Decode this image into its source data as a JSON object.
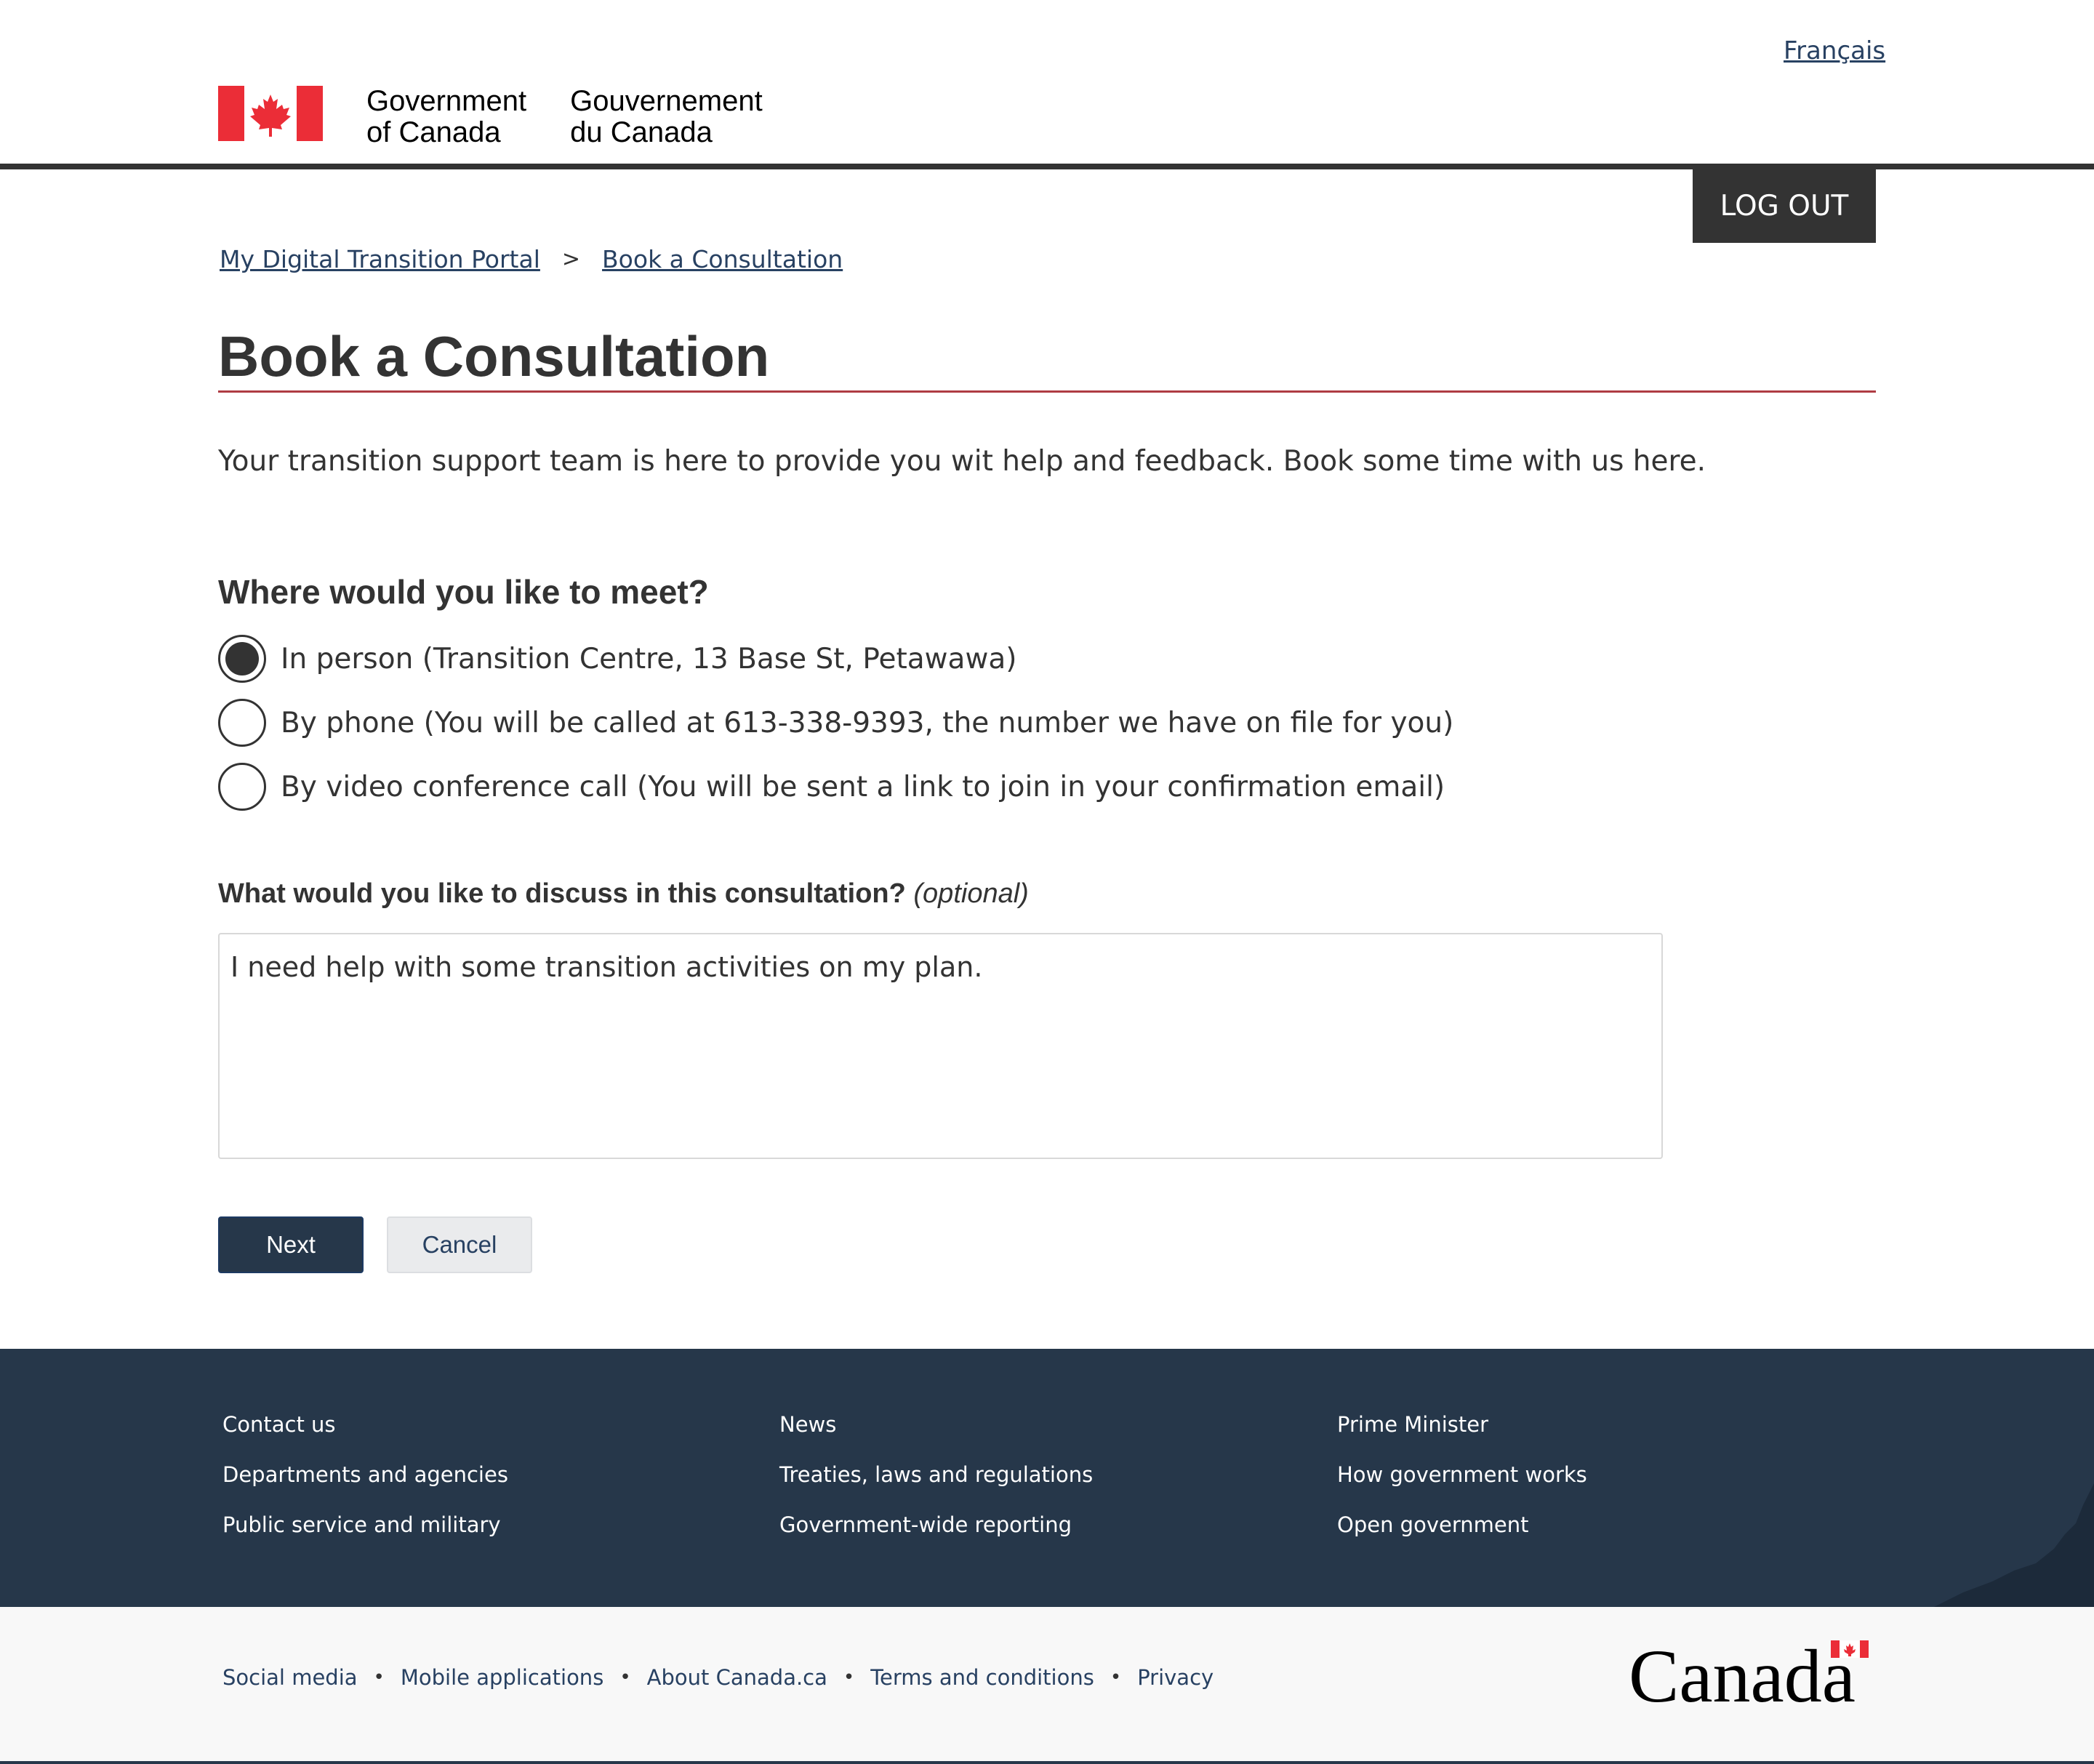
{
  "header": {
    "language_link": "Français",
    "signature_en_line1": "Government",
    "signature_en_line2": "of Canada",
    "signature_fr_line1": "Gouvernement",
    "signature_fr_line2": "du Canada",
    "logout_label": "LOG OUT"
  },
  "breadcrumb": {
    "items": [
      "My Digital Transition Portal",
      "Book a Consultation"
    ],
    "separator": ">"
  },
  "page": {
    "title": "Book a Consultation",
    "intro": "Your transition support team is here to provide you wit help and feedback.  Book some time with us here."
  },
  "meeting": {
    "legend": "Where would you like to meet?",
    "options": [
      {
        "label": "In person (Transition Centre, 13 Base St, Petawawa)",
        "checked": true
      },
      {
        "label": "By phone (You will be called at 613-338-9393, the number we have on file for you)",
        "checked": false
      },
      {
        "label": "By video conference call (You will be sent a link to join in your confirmation email)",
        "checked": false
      }
    ]
  },
  "discuss": {
    "label": "What would you like to discuss in this consultation?",
    "optional_tag": "(optional)",
    "value": "I need help with some transition activities on my plan."
  },
  "actions": {
    "next_label": "Next",
    "cancel_label": "Cancel"
  },
  "footer": {
    "columns": [
      [
        "Contact us",
        "Departments and agencies",
        "Public service and military"
      ],
      [
        "News",
        "Treaties, laws and regulations",
        "Government-wide reporting"
      ],
      [
        "Prime Minister",
        "How government works",
        "Open government"
      ]
    ],
    "sub_links": [
      "Social media",
      "Mobile applications",
      "About Canada.ca",
      "Terms and conditions",
      "Privacy"
    ],
    "wordmark": "Canada"
  },
  "colors": {
    "flag_red": "#eb2d37",
    "title_rule": "#af3c43",
    "footer_bg": "#26374a",
    "primary_button": "#26374a",
    "link": "#284162"
  }
}
